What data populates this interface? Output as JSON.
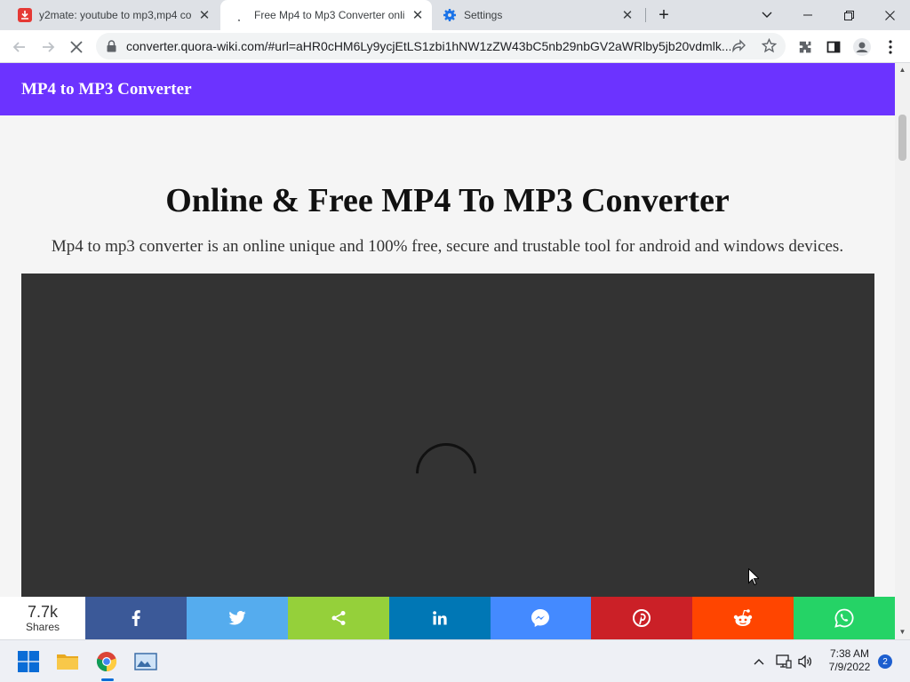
{
  "browser": {
    "tabs": [
      {
        "title": "y2mate: youtube to mp3,mp4 co",
        "icon": "download-icon",
        "active": false
      },
      {
        "title": "Free Mp4 to Mp3 Converter onli",
        "icon": "loading-icon",
        "active": true
      },
      {
        "title": "Settings",
        "icon": "gear-icon",
        "active": false
      }
    ],
    "url": "converter.quora-wiki.com/#url=aHR0cHM6Ly9ycjEtLS1zbi1hNW1zZW43bC5nb29nbGV2aWRlby5jb20vdmlk..."
  },
  "page": {
    "brand": "MP4 to MP3 Converter",
    "heading": "Online & Free MP4 To MP3 Converter",
    "subheading": "Mp4 to mp3 converter is an online unique and 100% free, secure and trustable tool for android and windows devices."
  },
  "share": {
    "count": "7.7k",
    "count_label": "Shares",
    "buttons": [
      {
        "name": "facebook",
        "color": "#3b5998"
      },
      {
        "name": "twitter",
        "color": "#55acee"
      },
      {
        "name": "share",
        "color": "#95d03a"
      },
      {
        "name": "linkedin",
        "color": "#0077b5"
      },
      {
        "name": "messenger",
        "color": "#448aff"
      },
      {
        "name": "pinterest",
        "color": "#cb2027"
      },
      {
        "name": "reddit",
        "color": "#ff4500"
      },
      {
        "name": "whatsapp",
        "color": "#25d366"
      }
    ]
  },
  "taskbar": {
    "time": "7:38 AM",
    "date": "7/9/2022",
    "notifications": "2"
  },
  "colors": {
    "navbar": "#6c33ff",
    "player_bg": "#333333"
  }
}
